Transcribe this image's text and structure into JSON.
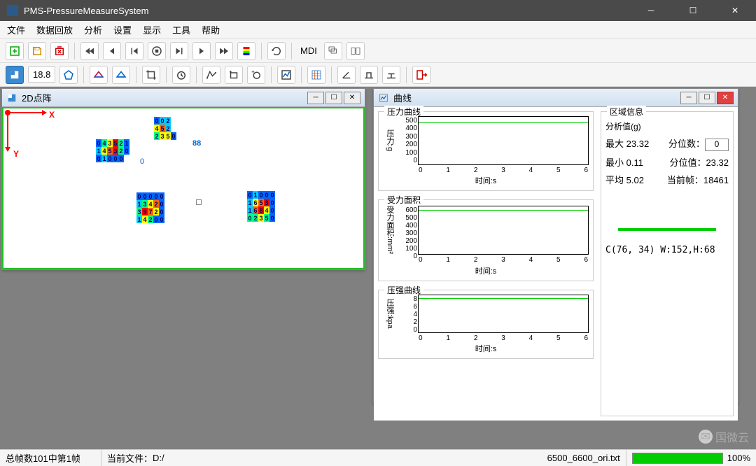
{
  "window": {
    "title": "PMS-PressureMeasureSystem"
  },
  "menu": [
    "文件",
    "数据回放",
    "分析",
    "设置",
    "显示",
    "工具",
    "帮助"
  ],
  "toolbar1": {
    "mdi_label": "MDI"
  },
  "toolbar2": {
    "value_box": "18.8"
  },
  "mdi": {
    "win2d": {
      "title": "2D点阵",
      "x_label": "X",
      "y_label": "Y",
      "zero": "0",
      "extra88": "88"
    },
    "curve": {
      "title": "曲线"
    }
  },
  "curve_panel": {
    "pressure_group": "压力曲线",
    "area_group": "受力面积",
    "stress_group": "压强曲线",
    "pressure_ylabel": "压力:g",
    "area_ylabel": "受力面积:mm²",
    "stress_ylabel": "压强:kpa",
    "xlabel": "时间:s"
  },
  "info": {
    "title": "区域信息",
    "analysis_label": "分析值(g)",
    "max_label": "最大",
    "max_val": "23.32",
    "quantile_label": "分位数：",
    "quantile_val": "0",
    "min_label": "最小",
    "min_val": "0.11",
    "quantile_value_label": "分位值：",
    "quantile_value": "23.32",
    "avg_label": "平均",
    "avg_val": "5.02",
    "frame_label": "当前帧：",
    "frame_val": "18461",
    "coord": "C(76, 34)  W:152,H:68"
  },
  "status": {
    "frames": "总帧数101中第1帧",
    "file_label": "当前文件：",
    "file_path": "D:/",
    "file_suffix": "6500_6600_ori.txt",
    "progress": "100%"
  },
  "watermark": "国微云",
  "chart_data": [
    {
      "type": "line",
      "name": "pressure",
      "ylabel": "压力:g",
      "xlabel": "时间:s",
      "ylim": [
        0,
        500
      ],
      "xlim": [
        0,
        6.5
      ],
      "yticks": [
        0,
        100,
        200,
        300,
        400,
        500
      ],
      "xticks": [
        0,
        1,
        2,
        3,
        4,
        5,
        6
      ],
      "series": [
        {
          "name": "pressure",
          "x": [
            0,
            6.5
          ],
          "values": [
            450,
            450
          ]
        }
      ]
    },
    {
      "type": "line",
      "name": "area",
      "ylabel": "受力面积:mm²",
      "xlabel": "时间:s",
      "ylim": [
        0,
        600
      ],
      "xlim": [
        0,
        6.5
      ],
      "yticks": [
        0,
        100,
        200,
        300,
        400,
        500,
        600
      ],
      "xticks": [
        0,
        1,
        2,
        3,
        4,
        5,
        6
      ],
      "series": [
        {
          "name": "area",
          "x": [
            0,
            6.5
          ],
          "values": [
            580,
            580
          ]
        }
      ]
    },
    {
      "type": "line",
      "name": "stress",
      "ylabel": "压强:kpa",
      "xlabel": "时间:s",
      "ylim": [
        0,
        8
      ],
      "xlim": [
        0,
        6.5
      ],
      "yticks": [
        0,
        2,
        4,
        6,
        8
      ],
      "xticks": [
        0,
        1,
        2,
        3,
        4,
        5,
        6
      ],
      "series": [
        {
          "name": "stress",
          "x": [
            0,
            6.5
          ],
          "values": [
            7.6,
            7.6
          ]
        }
      ]
    }
  ]
}
